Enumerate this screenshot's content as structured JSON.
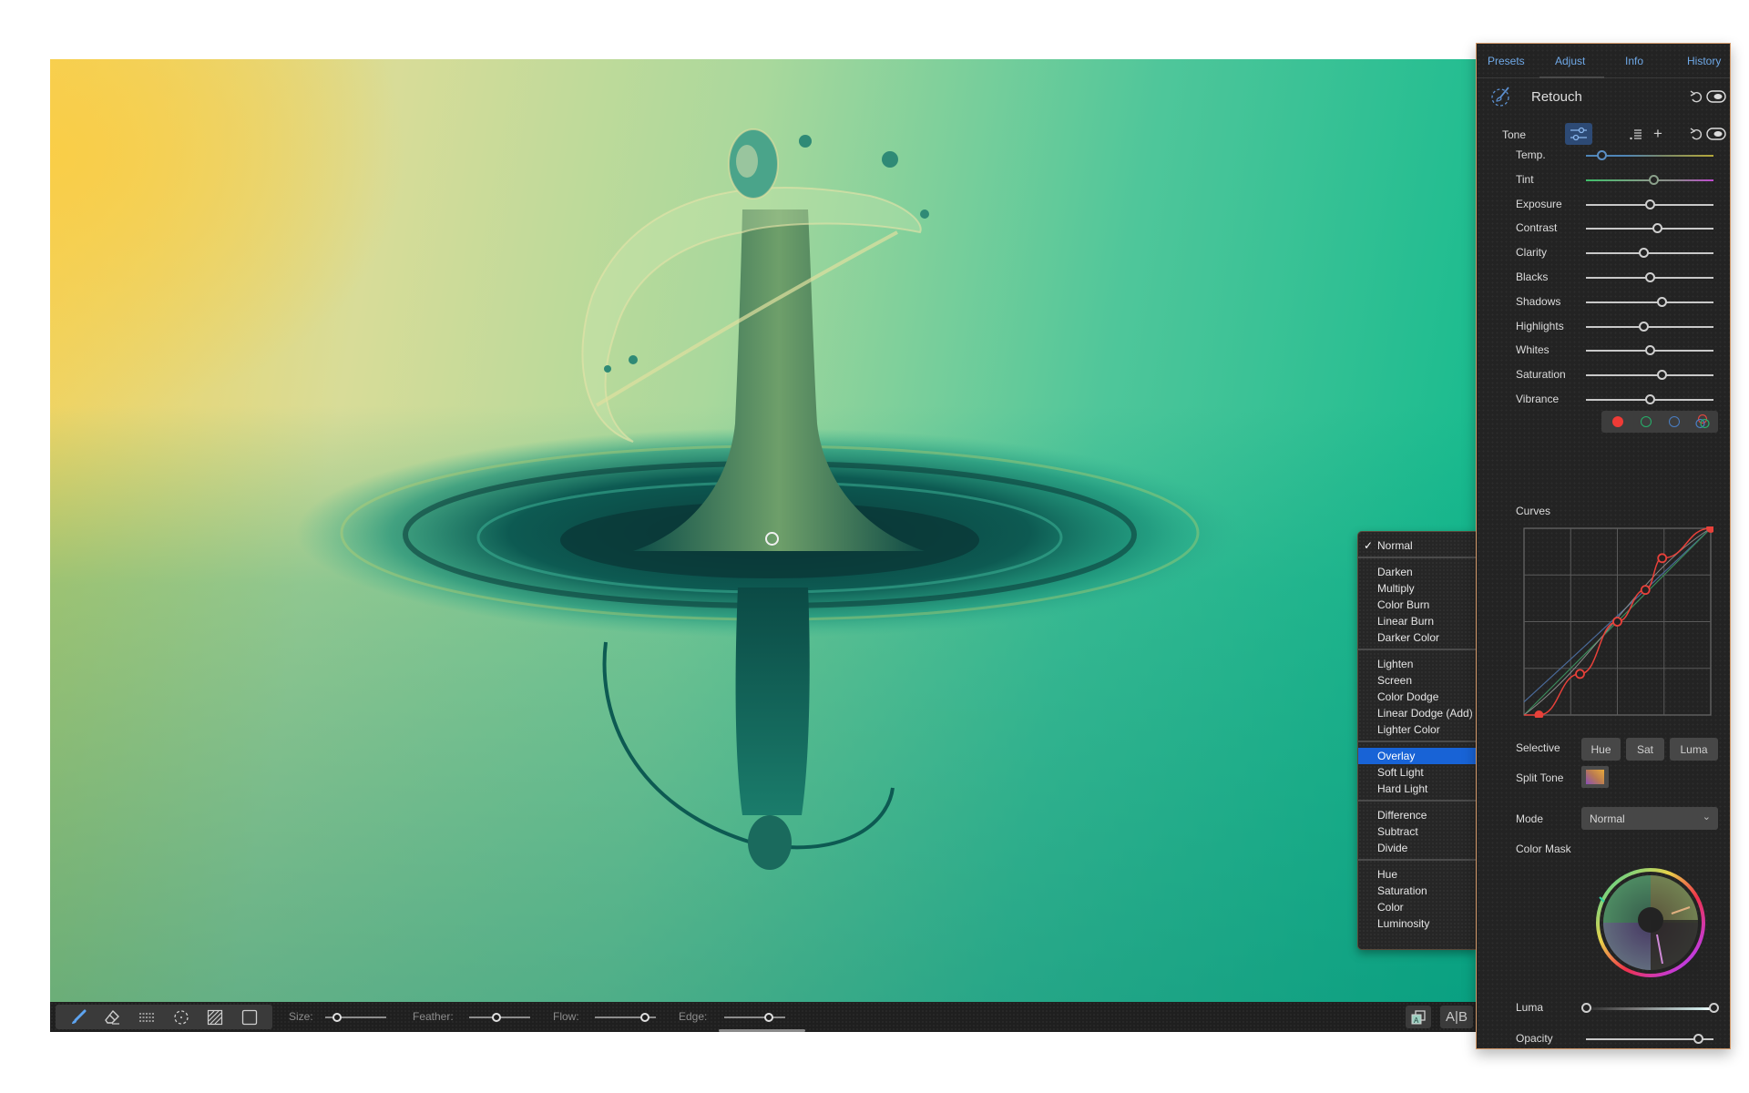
{
  "canvas": {
    "photo_description": "water droplet splash macro photo",
    "cursor": "brush-cursor-circle"
  },
  "toolbar": {
    "tools": [
      {
        "name": "brush-tool",
        "active": true
      },
      {
        "name": "eraser-tool",
        "active": false
      },
      {
        "name": "gradient-tool",
        "active": false
      },
      {
        "name": "radial-tool",
        "active": false
      },
      {
        "name": "fill-tool",
        "active": false
      },
      {
        "name": "clear-tool",
        "active": false
      }
    ],
    "size_label": "Size:",
    "feather_label": "Feather:",
    "flow_label": "Flow:",
    "edge_label": "Edge:",
    "size_value": 0.12,
    "feather_value": 0.38,
    "flow_value": 0.75,
    "edge_value": 0.65,
    "ab_label": "A|B",
    "overlay_btn_label": "A"
  },
  "panel": {
    "tabs": [
      "Presets",
      "Adjust",
      "Info",
      "History"
    ],
    "active_tab": "Adjust",
    "section_title": "Retouch",
    "tone_label": "Tone",
    "sliders": [
      {
        "label": "Temp.",
        "value": 0.12
      },
      {
        "label": "Tint",
        "value": 0.53
      },
      {
        "label": "Exposure",
        "value": 0.5
      },
      {
        "label": "Contrast",
        "value": 0.56
      },
      {
        "label": "Clarity",
        "value": 0.45
      },
      {
        "label": "Blacks",
        "value": 0.5
      },
      {
        "label": "Shadows",
        "value": 0.59
      },
      {
        "label": "Highlights",
        "value": 0.45
      },
      {
        "label": "Whites",
        "value": 0.5
      },
      {
        "label": "Saturation",
        "value": 0.59
      },
      {
        "label": "Vibrance",
        "value": 0.5
      }
    ],
    "curves_label": "Curves",
    "curve_channels": [
      "red",
      "green",
      "blue",
      "rgb"
    ],
    "active_curve_channel": "red",
    "curve_points": [
      [
        0.08,
        0.0
      ],
      [
        0.3,
        0.22
      ],
      [
        0.5,
        0.5
      ],
      [
        0.65,
        0.67
      ],
      [
        0.74,
        0.84
      ],
      [
        1.0,
        1.0
      ]
    ],
    "selective_label": "Selective",
    "selective_buttons": [
      "Hue",
      "Sat",
      "Luma"
    ],
    "split_tone_label": "Split Tone",
    "mode_label": "Mode",
    "mode_value": "Normal",
    "color_mask_label": "Color Mask",
    "luma_label": "Luma",
    "luma_range": [
      0.0,
      1.0
    ],
    "opacity_label": "Opacity",
    "opacity_value": 0.88
  },
  "blend_menu": {
    "groups": [
      [
        "Normal"
      ],
      [
        "Darken",
        "Multiply",
        "Color Burn",
        "Linear Burn",
        "Darker Color"
      ],
      [
        "Lighten",
        "Screen",
        "Color Dodge",
        "Linear Dodge (Add)",
        "Lighter Color"
      ],
      [
        "Overlay",
        "Soft Light",
        "Hard Light"
      ],
      [
        "Difference",
        "Subtract",
        "Divide"
      ],
      [
        "Hue",
        "Saturation",
        "Color",
        "Luminosity"
      ]
    ],
    "checked": "Normal",
    "highlighted": "Overlay"
  },
  "colors": {
    "accent": "#1863d6",
    "tab_active": "#6fa8e6",
    "curve_red": "#e8413a",
    "panel_bg": "#232323"
  }
}
